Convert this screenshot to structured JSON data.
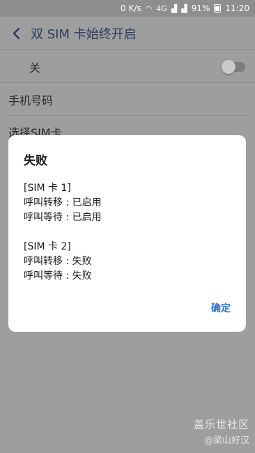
{
  "status_bar": {
    "speed": "0 K/s",
    "network": "4G",
    "battery": "91%",
    "time": "11:20"
  },
  "app_bar": {
    "title": "双 SIM 卡始终开启"
  },
  "settings": {
    "toggle_label": "关",
    "toggle_on": false,
    "items": [
      {
        "label": "手机号码"
      },
      {
        "label": "选择SIM卡"
      }
    ]
  },
  "dialog": {
    "title": "失败",
    "sim1_header": "[SIM 卡 1]",
    "sim1_lines": [
      "呼叫转移 : 已启用",
      "呼叫等待 : 已启用"
    ],
    "sim2_header": "[SIM 卡 2]",
    "sim2_lines": [
      "呼叫转移 : 失败",
      "呼叫等待 : 失败"
    ],
    "confirm_label": "确定"
  },
  "watermark": {
    "line1": "盖乐世社区",
    "line2": "@梁山好汉"
  },
  "colors": {
    "accent": "#2a6fc9",
    "title_text": "#2b3a5a",
    "scrim": "#9e9e9e"
  }
}
